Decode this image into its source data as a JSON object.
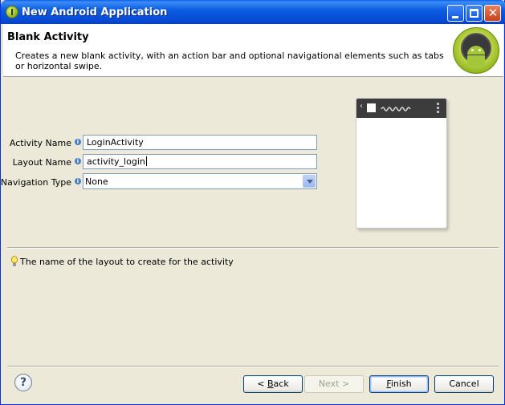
{
  "window": {
    "title": "New Android Application"
  },
  "header": {
    "heading": "Blank Activity",
    "description": "Creates a new blank activity, with an action bar and optional navigational elements such as tabs or horizontal swipe."
  },
  "form": {
    "activity_name": {
      "label": "Activity Name",
      "value": "LoginActivity"
    },
    "layout_name": {
      "label": "Layout Name",
      "value": "activity_login"
    },
    "navigation_type": {
      "label": "Navigation Type",
      "value": "None"
    }
  },
  "hint": {
    "text": "The name of the layout to create for the activity"
  },
  "buttons": {
    "help": "?",
    "back_prefix": "< ",
    "back_mnemonic": "B",
    "back_rest": "ack",
    "next": "Next >",
    "finish_mnemonic": "F",
    "finish_rest": "inish",
    "cancel": "Cancel"
  },
  "icons": {
    "info": "info-icon",
    "hint": "lightbulb-icon",
    "dropdown": "chevron-down-icon"
  },
  "colors": {
    "titlebar": "#0548d5",
    "dialog_background": "#ece9d8",
    "android_green": "#a4c639",
    "field_border": "#7f9db9"
  }
}
